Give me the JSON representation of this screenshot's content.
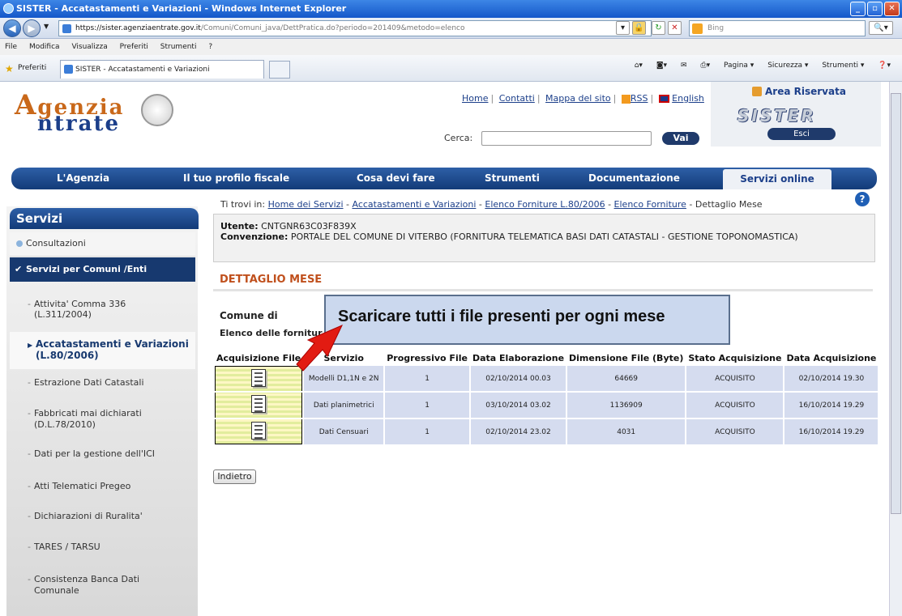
{
  "window": {
    "title": "SISTER - Accatastamenti e Variazioni - Windows Internet Explorer"
  },
  "browser": {
    "url_host": "https://sister.agenziaentrate.gov.it",
    "url_path": "/Comuni/Comuni_java/DettPratica.do?periodo=201409&metodo=elenco",
    "search_placeholder": "Bing",
    "menu": [
      "File",
      "Modifica",
      "Visualizza",
      "Preferiti",
      "Strumenti",
      "?"
    ],
    "favorites_label": "Preferiti",
    "tab_title": "SISTER - Accatastamenti e Variazioni",
    "cmd": [
      "Pagina ▾",
      "Sicurezza ▾",
      "Strumenti ▾"
    ]
  },
  "header": {
    "logo_line1": "genzia",
    "logo_line2": "ntrate",
    "links": [
      "Home",
      "Contatti",
      "Mappa del sito",
      "RSS",
      "English"
    ],
    "search_label": "Cerca:",
    "search_button": "Vai",
    "area_title": "Area Riservata",
    "brand": "SISTER",
    "logout": "Esci"
  },
  "nav": {
    "items": [
      "L'Agenzia",
      "Il tuo profilo fiscale",
      "Cosa devi fare",
      "Strumenti",
      "Documentazione"
    ],
    "active": "Servizi online"
  },
  "breadcrumb": {
    "prefix": "Ti trovi in:",
    "links": [
      "Home dei Servizi",
      "Accatastamenti e Variazioni",
      "Elenco Forniture L.80/2006",
      "Elenco Forniture"
    ],
    "current": "Dettaglio Mese"
  },
  "sidebar": {
    "title": "Servizi",
    "consultazioni": "Consultazioni",
    "comuni": "Servizi per Comuni /Enti",
    "items": [
      "Attivita' Comma 336 (L.311/2004)",
      "Accatastamenti e Variazioni (L.80/2006)",
      "Estrazione Dati Catastali",
      "Fabbricati mai dichiarati (D.L.78/2010)",
      "Dati per la gestione dell'ICI",
      "Atti Telematici Pregeo",
      "Dichiarazioni di Ruralita'",
      "TARES / TARSU",
      "Consistenza Banca Dati Comunale"
    ]
  },
  "info": {
    "utente_label": "Utente:",
    "utente": "CNTGNR63C03F839X",
    "conv_label": "Convenzione:",
    "convenzione": "PORTALE DEL COMUNE DI VITERBO (FORNITURA TELEMATICA BASI DATI CATASTALI - GESTIONE TOPONOMASTICA)"
  },
  "main": {
    "heading": "DETTAGLIO MESE",
    "comune_label": "Comune di",
    "elenco_label": "Elenco delle fornitur",
    "callout": "Scaricare tutti  i file presenti  per ogni mese",
    "back_button": "Indietro"
  },
  "table": {
    "headers": [
      "Acquisizione File",
      "Servizio",
      "Progressivo File",
      "Data Elaborazione",
      "Dimensione File (Byte)",
      "Stato Acquisizione",
      "Data Acquisizione"
    ],
    "rows": [
      [
        "Modelli D1,1N e 2N",
        "1",
        "02/10/2014 00.03",
        "64669",
        "ACQUISITO",
        "02/10/2014 19.30"
      ],
      [
        "Dati planimetrici",
        "1",
        "03/10/2014 03.02",
        "1136909",
        "ACQUISITO",
        "16/10/2014 19.29"
      ],
      [
        "Dati Censuari",
        "1",
        "02/10/2014 23.02",
        "4031",
        "ACQUISITO",
        "16/10/2014 19.29"
      ]
    ]
  },
  "colors": {
    "accent": "#1c3f8a",
    "orange": "#c0501d",
    "callout_bg": "#cbd8ee"
  }
}
